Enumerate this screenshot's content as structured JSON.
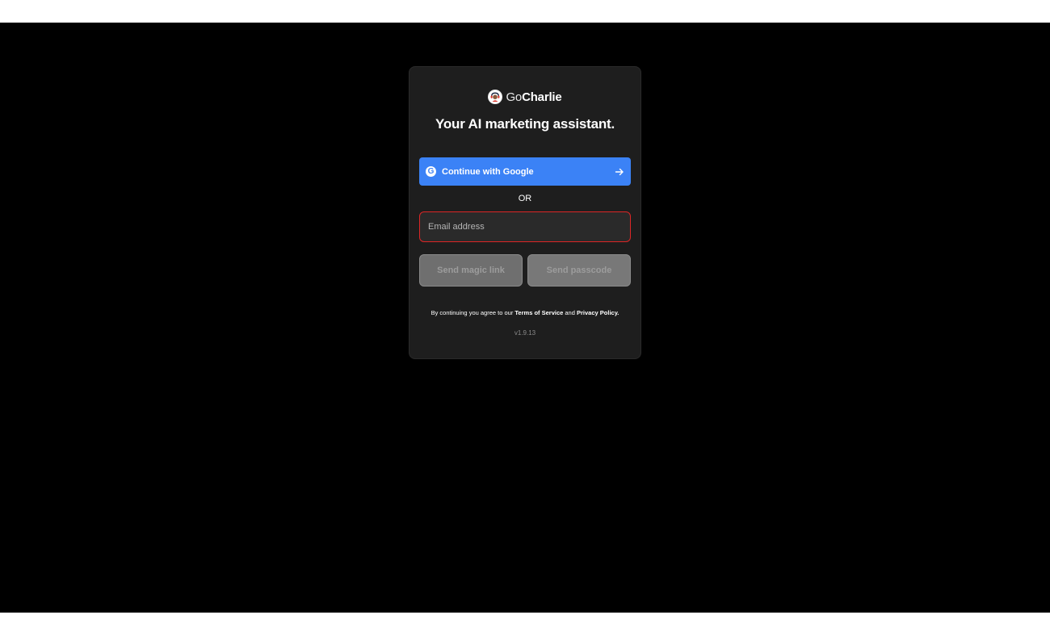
{
  "brand": {
    "name_prefix": "Go",
    "name_suffix": "Charlie"
  },
  "tagline": "Your AI marketing assistant.",
  "google_button": {
    "label": "Continue with Google",
    "icon": "google-g-icon"
  },
  "divider": "OR",
  "email_input": {
    "placeholder": "Email address",
    "value": ""
  },
  "actions": {
    "magic_link_label": "Send magic link",
    "passcode_label": "Send passcode"
  },
  "terms": {
    "prefix": "By continuing you agree to our",
    "tos_label": "Terms of Service",
    "and": "and",
    "privacy_label": "Privacy Policy."
  },
  "version": "v1.9.13",
  "colors": {
    "accent": "#3b82f6",
    "error_border": "#dc2626",
    "card_bg": "#1e1e1e",
    "page_bg": "#000000"
  }
}
